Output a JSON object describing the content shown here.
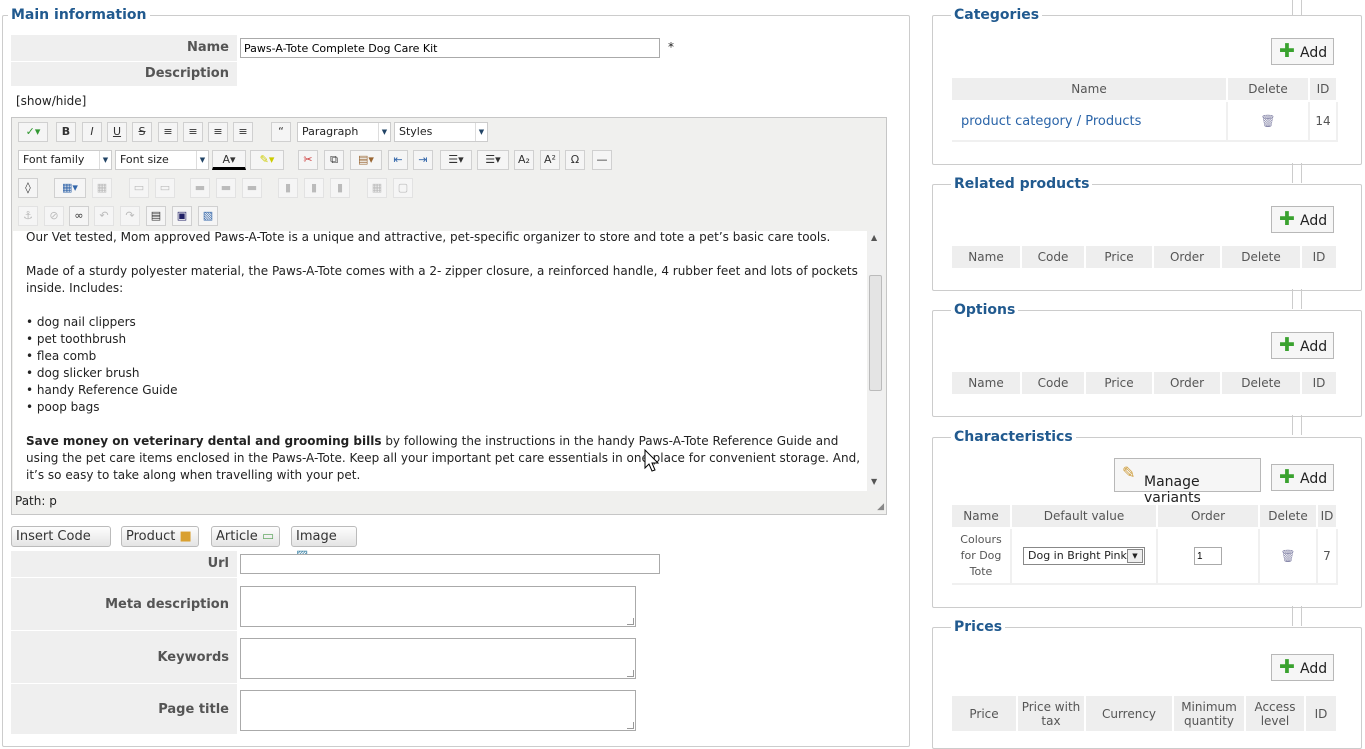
{
  "main": {
    "legend": "Main information",
    "name_label": "Name",
    "name_value": "Paws-A-Tote Complete Dog Care Kit",
    "required_mark": "*",
    "description_label": "Description",
    "show_hide": "[show/hide]",
    "toolbar": {
      "paragraph_select": "Paragraph",
      "styles_select": "Styles",
      "font_family_select": "Font family",
      "font_size_select": "Font size"
    },
    "content": {
      "p1": "Our Vet tested, Mom approved Paws-A-Tote is a unique and attractive, pet-specific organizer to store and tote a pet’s basic care tools.",
      "p2": "Made of a sturdy polyester material, the Paws-A-Tote comes with a 2- zipper closure, a reinforced handle, 4 rubber feet and lots of pockets inside. Includes:",
      "items": [
        "dog nail clippers",
        "pet toothbrush",
        "flea comb",
        "dog slicker brush",
        "handy Reference Guide",
        "poop bags"
      ],
      "p3_bold": "Save money on veterinary dental and grooming bills",
      "p3_rest": " by following the instructions in the handy Paws-A-Tote Reference Guide and using the pet care items enclosed in the Paws-A-Tote. Keep all your important pet care essentials in one place for convenient storage. And, it’s so easy to take along when travelling with your pet."
    },
    "path_label": "Path:",
    "path_value": "p",
    "buttons": {
      "insert_code": "Insert Code",
      "product": "Product",
      "article": "Article",
      "image": "Image"
    },
    "url_label": "Url",
    "url_value": "",
    "meta_description_label": "Meta description",
    "keywords_label": "Keywords",
    "page_title_label": "Page title"
  },
  "categories": {
    "legend": "Categories",
    "add_label": "Add",
    "columns": [
      "Name",
      "Delete",
      "ID"
    ],
    "rows": [
      {
        "name": "product category / Products",
        "id": "14"
      }
    ]
  },
  "related_products": {
    "legend": "Related products",
    "add_label": "Add",
    "columns": [
      "Name",
      "Code",
      "Price",
      "Order",
      "Delete",
      "ID"
    ]
  },
  "options": {
    "legend": "Options",
    "add_label": "Add",
    "columns": [
      "Name",
      "Code",
      "Price",
      "Order",
      "Delete",
      "ID"
    ]
  },
  "characteristics": {
    "legend": "Characteristics",
    "manage_variants_label": "Manage variants",
    "add_label": "Add",
    "columns": [
      "Name",
      "Default value",
      "Order",
      "Delete",
      "ID"
    ],
    "rows": [
      {
        "name": "Colours for Dog Tote",
        "default_value": "Dog in Bright Pink",
        "order": "1",
        "id": "7"
      }
    ]
  },
  "prices": {
    "legend": "Prices",
    "add_label": "Add",
    "columns": [
      "Price",
      "Price with tax",
      "Currency",
      "Minimum quantity",
      "Access level",
      "ID"
    ]
  },
  "colors": {
    "legend": "#215a8f",
    "link": "#2a64a8",
    "add_plus": "#3aa22f"
  }
}
